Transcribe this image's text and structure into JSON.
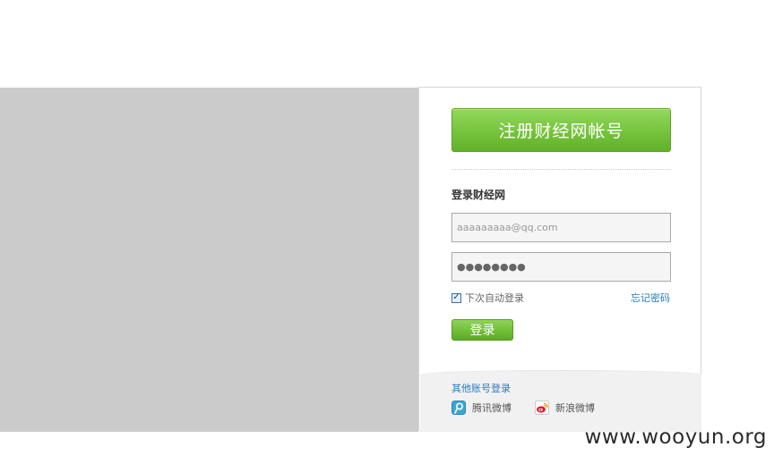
{
  "register": {
    "label": "注册财经网帐号"
  },
  "login": {
    "section_title": "登录财经网",
    "email_value": "aaaaaaaaa@qq.com",
    "password_value": "●●●●●●●●",
    "remember_label": "下次自动登录",
    "remember_checked": true,
    "forgot_label": "忘记密码",
    "submit_label": "登录"
  },
  "other_login": {
    "title": "其他账号登录",
    "providers": [
      {
        "label": "腾讯微博",
        "icon": "tencent-weibo-icon"
      },
      {
        "label": "新浪微博",
        "icon": "sina-weibo-icon"
      }
    ]
  },
  "watermark": "www.wooyun.org",
  "colors": {
    "brand_green": "#76c33c",
    "link_blue": "#1f7dc9",
    "panel_gray": "#cbcbcb"
  }
}
